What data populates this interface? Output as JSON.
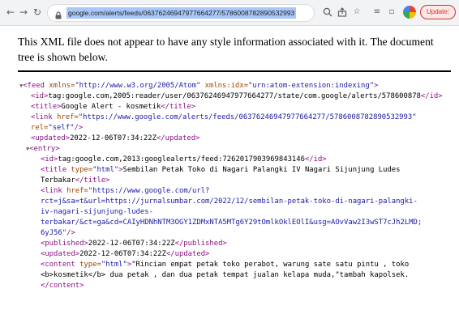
{
  "browser": {
    "url": "google.com/alerts/feeds/06376246947977664277/5786008782890532993",
    "update_label": "Update",
    "colors": {
      "toolbar_bg": "#f1f3f4",
      "url_selection": "#a8c7fa",
      "update_accent": "#d93025"
    }
  },
  "notice": {
    "text": "This XML file does not appear to have any style information associated with it. The document tree is shown below."
  },
  "xml": {
    "colors": {
      "tag": "#881280",
      "attr_name": "#994500",
      "attr_value": "#1a1aa6"
    },
    "feed_open": {
      "open": "<feed ",
      "attr1": "xmlns=",
      "val1": "\"http://www.w3.org/2005/Atom\"",
      "attr2": " xmlns:idx=",
      "val2": "\"urn:atom-extension:indexing\"",
      "close": ">"
    },
    "id": {
      "open": "<id>",
      "text": "tag:google.com,2005:reader/user/06376246947977664277/state/com.google/alerts/578600878",
      "close": "</id>"
    },
    "title": {
      "open": "<title>",
      "text": "Google Alert - kosmetik",
      "close": "</title>"
    },
    "link": {
      "open": "<link ",
      "attr": "href=",
      "val": "\"https://www.google.com/alerts/feeds/06376246947977664277/5786008782890532993\"",
      "rel_attr": "rel=",
      "rel_val": "\"self\"",
      "end": "/>"
    },
    "updated": {
      "open": "<updated>",
      "text": "2022-12-06T07:34:22Z",
      "close": "</updated>"
    },
    "entry": {
      "open": "<entry>",
      "id": {
        "open": "<id>",
        "text": "tag:google.com,2013:googlealerts/feed:7262017903969843146",
        "close": "</id>"
      },
      "title": {
        "open": "<title ",
        "attr": "type=",
        "val": "\"html\"",
        "gt": ">",
        "text1": "Sembilan Petak Toko di Nagari Palangki IV Nagari Sijunjung Ludes",
        "text2": "Terbakar",
        "close": "</title>"
      },
      "link": {
        "open": "<link ",
        "attr": "href=",
        "val1": "\"https://www.google.com/url?",
        "val2": "rct=j&sa=t&url=https://jurnalsumbar.com/2022/12/sembilan-petak-toko-di-nagari-palangki-",
        "val3": "iv-nagari-sijunjung-ludes-",
        "val4": "terbakar/&ct=ga&cd=CAIyHDNhNTM3OGY1ZDMxNTA5MTg6Y29tOmlkOklEOlI&usg=AOvVaw2I3wST7cJh2LMD;",
        "val5": "6yJ56\"",
        "end": "/>"
      },
      "published": {
        "open": "<published>",
        "text": "2022-12-06T07:34:22Z",
        "close": "</published>"
      },
      "updated": {
        "open": "<updated>",
        "text": "2022-12-06T07:34:22Z",
        "close": "</updated>"
      },
      "content": {
        "open": "<content ",
        "attr": "type=",
        "val": "\"html\"",
        "gt": ">",
        "text1": "\"Rincian empat petak toko perabot, warung sate satu pintu , toko",
        "text2": "<b>kosmetik</b> dua petak , dan dua petak tempat jualan kelapa muda,\"tambah kapolsek.",
        "close": "</content>"
      }
    }
  }
}
